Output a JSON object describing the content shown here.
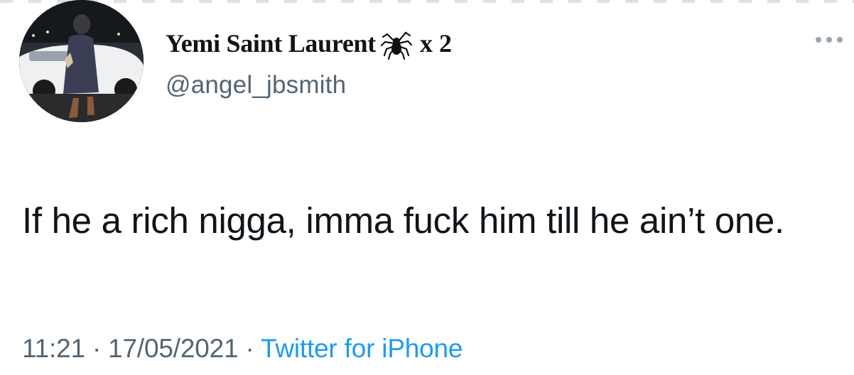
{
  "user": {
    "display_name": "Yemi Saint Laurent",
    "name_suffix": "x 2",
    "handle": "@angel_jbsmith",
    "avatar_icon": "profile-photo",
    "emoji_icon": "spider-icon"
  },
  "menu": {
    "icon": "more-options-icon"
  },
  "tweet": {
    "text": "If he a rich nigga, imma fuck him till he ain’t one.",
    "time": "11:21",
    "separator": "·",
    "date": "17/05/2021",
    "source": "Twitter for iPhone"
  },
  "colors": {
    "text": "#0f1419",
    "secondary": "#536471",
    "link": "#1d9bf0"
  }
}
